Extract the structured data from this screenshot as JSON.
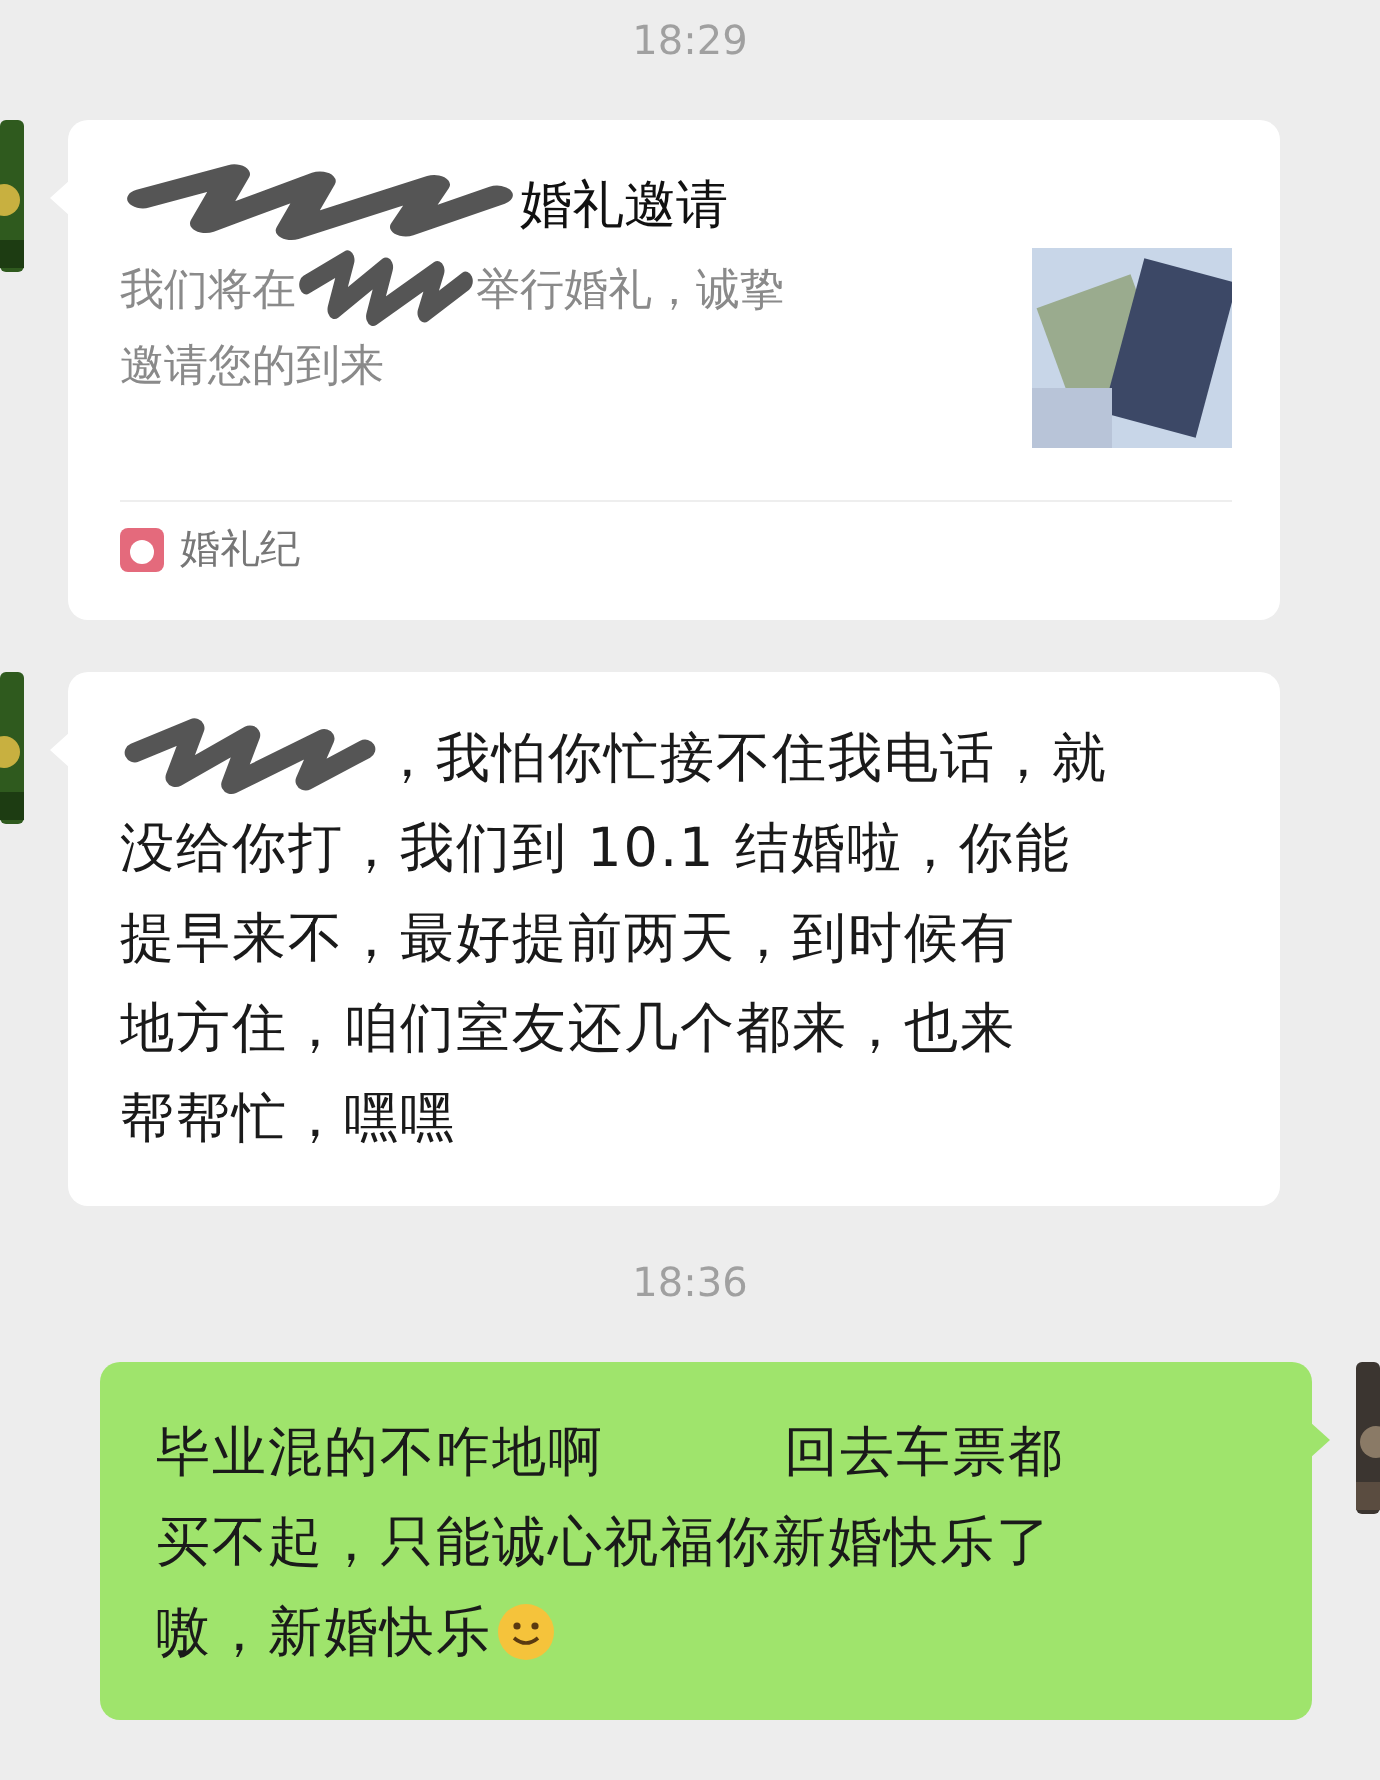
{
  "messages": [
    {
      "kind": "time",
      "text": "18:29"
    },
    {
      "kind": "card",
      "title": [
        {
          "kind": "scribble"
        },
        {
          "kind": "text",
          "text": "婚礼邀请"
        }
      ],
      "description_lines": [
        [
          {
            "kind": "text",
            "text": "我们将在"
          },
          {
            "kind": "scribble"
          },
          {
            "kind": "text",
            "text": "举行婚礼，诚挚"
          }
        ],
        [
          {
            "kind": "text",
            "text": "邀请您的到来"
          }
        ]
      ],
      "source": "婚礼纪"
    },
    {
      "kind": "received",
      "lines": [
        [
          {
            "kind": "scribble"
          },
          {
            "kind": "text",
            "text": "，我怕你忙接不住我电话，就"
          }
        ],
        [
          {
            "kind": "text",
            "text": "没给你打，我们到 10.1 结婚啦，你能"
          }
        ],
        [
          {
            "kind": "text",
            "text": "提早来不，最好提前两天，到时候有"
          }
        ],
        [
          {
            "kind": "text",
            "text": "地方住，咱们室友还几个都来，也来"
          }
        ],
        [
          {
            "kind": "text",
            "text": "帮帮忙，嘿嘿"
          }
        ]
      ]
    },
    {
      "kind": "time",
      "text": "18:36"
    },
    {
      "kind": "sent",
      "lines": [
        [
          {
            "kind": "text",
            "text": "毕业混的不咋地啊"
          },
          {
            "kind": "blank"
          },
          {
            "kind": "text",
            "text": "回去车票都"
          }
        ],
        [
          {
            "kind": "text",
            "text": "买不起，只能诚心祝福你新婚快乐了"
          }
        ],
        [
          {
            "kind": "text",
            "text": "嗷，新婚快乐"
          },
          {
            "kind": "emoji"
          }
        ]
      ]
    }
  ]
}
